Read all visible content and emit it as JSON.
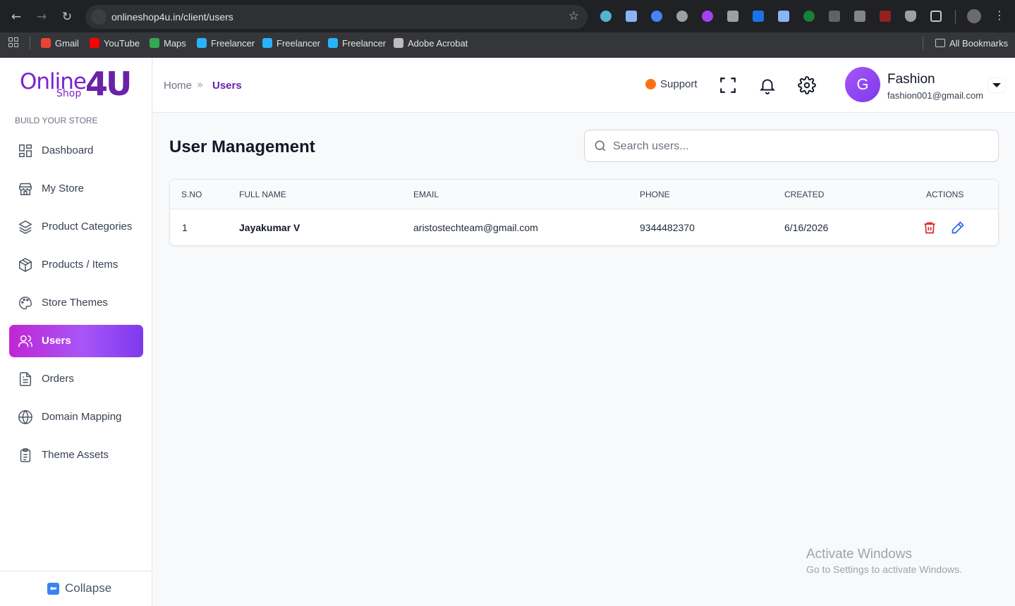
{
  "browser": {
    "url": "onlineshop4u.in/client/users",
    "bookmarks": [
      {
        "label": "Gmail",
        "color": "#ea4335"
      },
      {
        "label": "YouTube",
        "color": "#ff0000"
      },
      {
        "label": "Maps",
        "color": "#34a853"
      },
      {
        "label": "Freelancer",
        "color": "#29b2fe"
      },
      {
        "label": "Freelancer",
        "color": "#29b2fe"
      },
      {
        "label": "Freelancer",
        "color": "#29b2fe"
      },
      {
        "label": "Adobe Acrobat",
        "color": "#bdbdbd"
      }
    ],
    "all_bookmarks": "All Bookmarks"
  },
  "sidebar": {
    "logo": {
      "online": "Online",
      "shop": "Shop",
      "brand": "4U"
    },
    "section_label": "BUILD YOUR STORE",
    "items": [
      {
        "label": "Dashboard",
        "icon": "grid-icon"
      },
      {
        "label": "My Store",
        "icon": "store-icon"
      },
      {
        "label": "Product Categories",
        "icon": "layers-icon"
      },
      {
        "label": "Products / Items",
        "icon": "box-icon"
      },
      {
        "label": "Store Themes",
        "icon": "palette-icon"
      },
      {
        "label": "Users",
        "icon": "users-icon",
        "active": true
      },
      {
        "label": "Orders",
        "icon": "document-icon"
      },
      {
        "label": "Domain Mapping",
        "icon": "globe-icon"
      },
      {
        "label": "Theme Assets",
        "icon": "clipboard-icon"
      }
    ],
    "collapse_label": "Collapse"
  },
  "header": {
    "breadcrumb": {
      "home": "Home",
      "separator": "»",
      "current": "Users"
    },
    "support_label": "Support",
    "user": {
      "initial": "G",
      "name": "Fashion",
      "email": "fashion001@gmail.com"
    }
  },
  "main": {
    "title": "User Management",
    "search_placeholder": "Search users...",
    "table": {
      "headers": {
        "sno": "S.NO",
        "name": "FULL NAME",
        "email": "EMAIL",
        "phone": "PHONE",
        "created": "CREATED",
        "actions": "ACTIONS"
      },
      "rows": [
        {
          "sno": "1",
          "name": "Jayakumar V",
          "email": "aristostechteam@gmail.com",
          "phone": "9344482370",
          "created": "6/16/2026"
        }
      ]
    }
  },
  "watermark": {
    "line1": "Activate Windows",
    "line2": "Go to Settings to activate Windows."
  },
  "colors": {
    "accent": "#a855f7",
    "brand": "#6b21a8",
    "delete": "#dc2626",
    "edit": "#2563eb"
  }
}
